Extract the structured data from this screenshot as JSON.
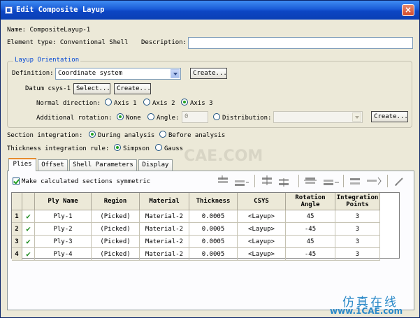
{
  "window": {
    "title": "Edit Composite Layup",
    "close_label": "×"
  },
  "name": {
    "label": "Name:",
    "value": "CompositeLayup-1"
  },
  "element_type": {
    "label": "Element type:",
    "value": "Conventional Shell"
  },
  "description": {
    "label": "Description:",
    "value": ""
  },
  "layup_orientation": {
    "legend": "Layup Orientation",
    "definition_label": "Definition:",
    "definition_value": "Coordinate system",
    "create_label": "Create...",
    "datum_label": "Datum csys-1",
    "select_label": "Select...",
    "datum_create_label": "Create...",
    "normal_direction_label": "Normal direction:",
    "normal_options": [
      "Axis 1",
      "Axis 2",
      "Axis 3"
    ],
    "normal_selected": "Axis 3",
    "additional_rotation_label": "Additional rotation:",
    "rotation_none": "None",
    "rotation_angle": "Angle:",
    "angle_value": "0",
    "rotation_distribution": "Distribution:",
    "distribution_value": "",
    "distribution_create_label": "Create..."
  },
  "section_integration": {
    "label": "Section integration:",
    "during": "During analysis",
    "before": "Before analysis"
  },
  "thickness_integration": {
    "label": "Thickness integration rule:",
    "simpson": "Simpson",
    "gauss": "Gauss"
  },
  "tabs": [
    "Plies",
    "Offset",
    "Shell Parameters",
    "Display"
  ],
  "symmetric_label": "Make calculated sections symmetric",
  "table": {
    "headers": [
      "Ply Name",
      "Region",
      "Material",
      "Thickness",
      "CSYS",
      "Rotation Angle",
      "Integration Points"
    ],
    "header_rotation": [
      "Rotation",
      "Angle"
    ],
    "header_integration": [
      "Integration",
      "Points"
    ],
    "rows": [
      {
        "num": "1",
        "ok": "✔",
        "ply": "Ply-1",
        "region": "(Picked)",
        "material": "Material-2",
        "thickness": "0.0005",
        "csys": "<Layup>",
        "rotation": "45",
        "points": "3"
      },
      {
        "num": "2",
        "ok": "✔",
        "ply": "Ply-2",
        "region": "(Picked)",
        "material": "Material-2",
        "thickness": "0.0005",
        "csys": "<Layup>",
        "rotation": "-45",
        "points": "3"
      },
      {
        "num": "3",
        "ok": "✔",
        "ply": "Ply-3",
        "region": "(Picked)",
        "material": "Material-2",
        "thickness": "0.0005",
        "csys": "<Layup>",
        "rotation": "45",
        "points": "3"
      },
      {
        "num": "4",
        "ok": "✔",
        "ply": "Ply-4",
        "region": "(Picked)",
        "material": "Material-2",
        "thickness": "0.0005",
        "csys": "<Layup>",
        "rotation": "-45",
        "points": "3"
      }
    ]
  },
  "watermark": {
    "cae": "CAE.COM",
    "brand_cn": "仿真在线",
    "brand_url": "www.1CAE.com"
  },
  "colors": {
    "title_bar": "#0a3fb5",
    "accent_tab": "#e68b2c",
    "brand": "#2a89c8",
    "check_green": "#21a121"
  }
}
